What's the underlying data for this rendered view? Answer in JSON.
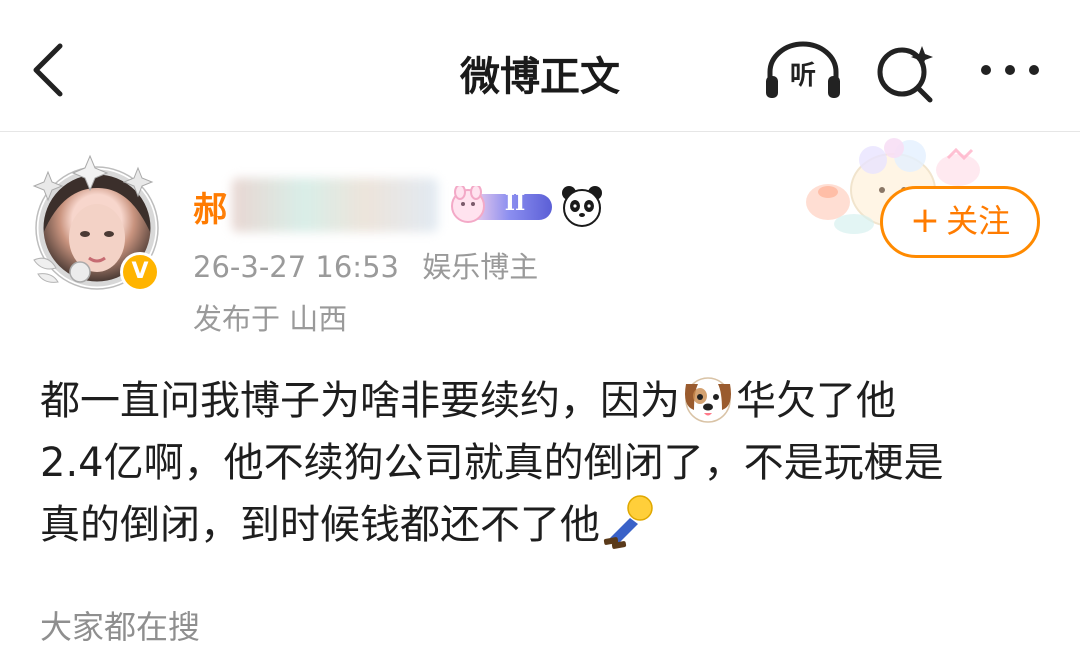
{
  "nav": {
    "title": "微博正文",
    "listen_label": "听"
  },
  "author": {
    "name_visible": "郝",
    "level": "II",
    "verified_mark": "V"
  },
  "post": {
    "date": "26-3-27 16:53",
    "category": "娱乐博主",
    "location": "发布于 山西",
    "line1_a": "都一直问我博子为啥非要续约，因为",
    "line1_b": "华欠了他",
    "line2": "2.4亿啊，他不续狗公司就真的倒闭了，不是玩梗是",
    "line3": "真的倒闭，到时候钱都还不了他"
  },
  "follow": {
    "plus": "+",
    "label": "关注"
  },
  "section": {
    "search_hint": "大家都在搜"
  },
  "colors": {
    "accent": "#ff7b00",
    "meta_text": "#9a9a9a",
    "body_text": "#1e1e1e"
  },
  "icons": [
    "back-arrow-icon",
    "headphones-icon",
    "search-sparkle-icon",
    "more-dots-icon",
    "verified-v-icon",
    "panda-icon",
    "dog-face-icon",
    "lying-person-icon"
  ]
}
